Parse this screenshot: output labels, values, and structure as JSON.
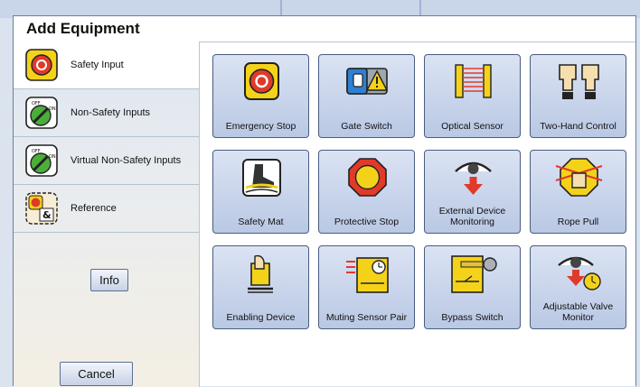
{
  "dialog": {
    "title": "Add Equipment"
  },
  "sidebar": {
    "items": [
      {
        "label": "Safety Input",
        "icon": "emergency-stop-icon",
        "selected": true
      },
      {
        "label": "Non-Safety Inputs",
        "icon": "off-on-switch-icon",
        "selected": false
      },
      {
        "label": "Virtual Non-Safety Inputs",
        "icon": "off-on-switch-icon",
        "selected": false
      },
      {
        "label": "Reference",
        "icon": "reference-icon",
        "selected": false
      }
    ],
    "info_label": "Info",
    "cancel_label": "Cancel",
    "switch_off_text": "OFF",
    "switch_on_text": "ON",
    "reference_symbol": "&"
  },
  "equipment": [
    {
      "label": "Emergency Stop",
      "icon": "emergency-stop-icon"
    },
    {
      "label": "Gate Switch",
      "icon": "gate-switch-icon"
    },
    {
      "label": "Optical Sensor",
      "icon": "optical-sensor-icon"
    },
    {
      "label": "Two-Hand Control",
      "icon": "two-hand-control-icon"
    },
    {
      "label": "Safety Mat",
      "icon": "safety-mat-icon"
    },
    {
      "label": "Protective Stop",
      "icon": "protective-stop-icon"
    },
    {
      "label": "External Device Monitoring",
      "icon": "external-device-monitoring-icon"
    },
    {
      "label": "Rope Pull",
      "icon": "rope-pull-icon"
    },
    {
      "label": "Enabling Device",
      "icon": "enabling-device-icon"
    },
    {
      "label": "Muting Sensor Pair",
      "icon": "muting-sensor-pair-icon"
    },
    {
      "label": "Bypass Switch",
      "icon": "bypass-switch-icon"
    },
    {
      "label": "Adjustable Valve Monitor",
      "icon": "adjustable-valve-monitor-icon"
    }
  ],
  "colors": {
    "accent_red": "#e03a2a",
    "accent_yellow": "#f5d21a",
    "tile_bg": "#c9d5ec"
  }
}
